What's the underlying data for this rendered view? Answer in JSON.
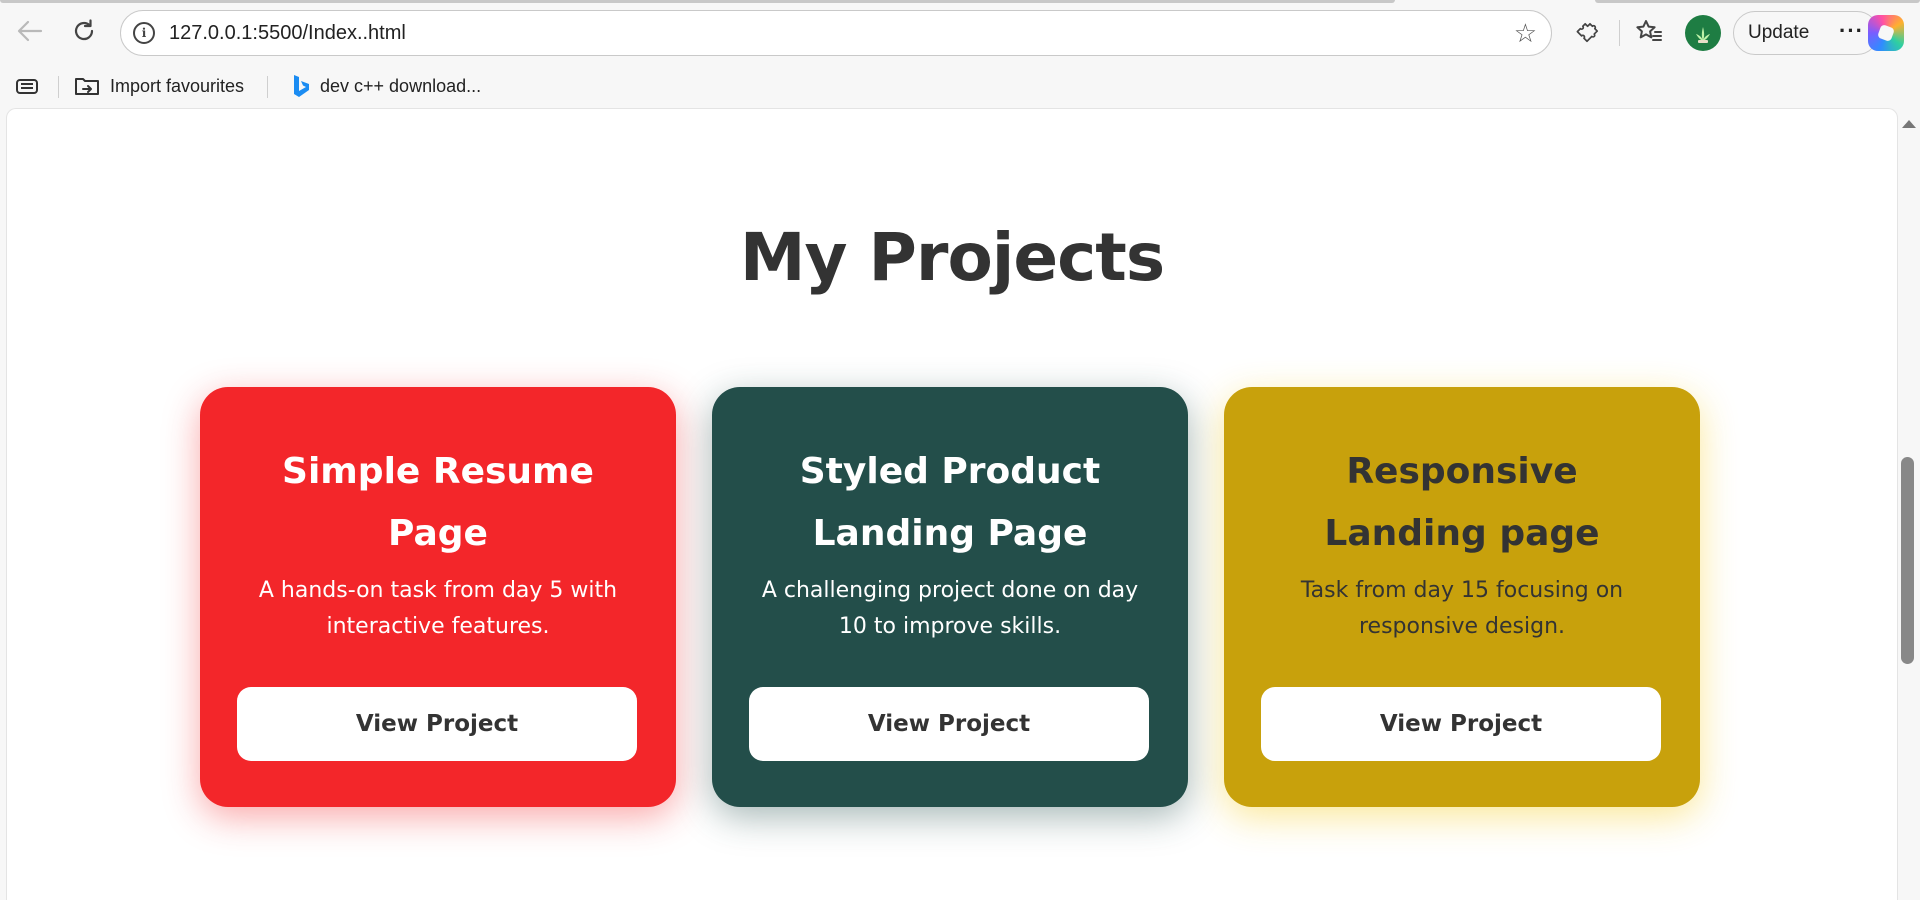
{
  "browser": {
    "url": "127.0.0.1:5500/Index..html",
    "update_label": "Update",
    "more_label": "···"
  },
  "favourites": {
    "items": [
      {
        "label": "Import favourites",
        "icon": "import-folder-icon"
      },
      {
        "label": "dev c++ download...",
        "icon": "bing-icon"
      }
    ]
  },
  "page": {
    "title": "My Projects",
    "projects": [
      {
        "title": "Simple Resume Page",
        "description": "A hands-on task from day 5 with interactive features.",
        "button": "View Project",
        "bg": "#f3262a",
        "text_color": "#ffffff"
      },
      {
        "title": "Styled Product Landing Page",
        "description": "A challenging project done on day 10 to improve skills.",
        "button": "View Project",
        "bg": "#234e4a",
        "text_color": "#ffffff"
      },
      {
        "title": "Responsive Landing page",
        "description": "Task from day 15 focusing on responsive design.",
        "button": "View Project",
        "bg": "#c8a10c",
        "text_color": "#333333"
      }
    ]
  }
}
